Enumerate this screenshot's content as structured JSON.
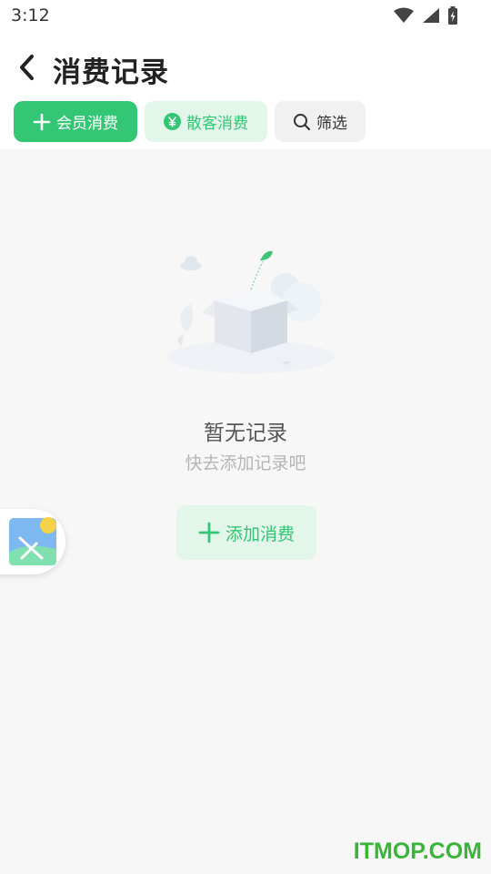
{
  "status_bar": {
    "time": "3:12",
    "icons": [
      "wifi-icon",
      "signal-icon",
      "battery-charging-icon"
    ]
  },
  "nav": {
    "back_icon": "chevron-left-icon",
    "title": "消费记录"
  },
  "filters": {
    "member_consume": {
      "label": "会员消费",
      "icon": "plus-icon"
    },
    "walkin_consume": {
      "label": "散客消费",
      "icon": "yen-coin-icon"
    },
    "filter": {
      "label": "筛选",
      "icon": "search-icon"
    }
  },
  "empty_state": {
    "illustration": "empty-box-illustration",
    "title": "暂无记录",
    "subtitle": "快去添加记录吧",
    "add_button": {
      "label": "添加消费",
      "icon": "plus-icon"
    }
  },
  "floating_widget": {
    "icon": "image-gallery-icon"
  },
  "watermark": "ITMOP.COM",
  "colors": {
    "accent": "#33c675",
    "accent_light": "#e2f6ea",
    "background": "#f7f7f7",
    "watermark": "#3ab53a"
  }
}
